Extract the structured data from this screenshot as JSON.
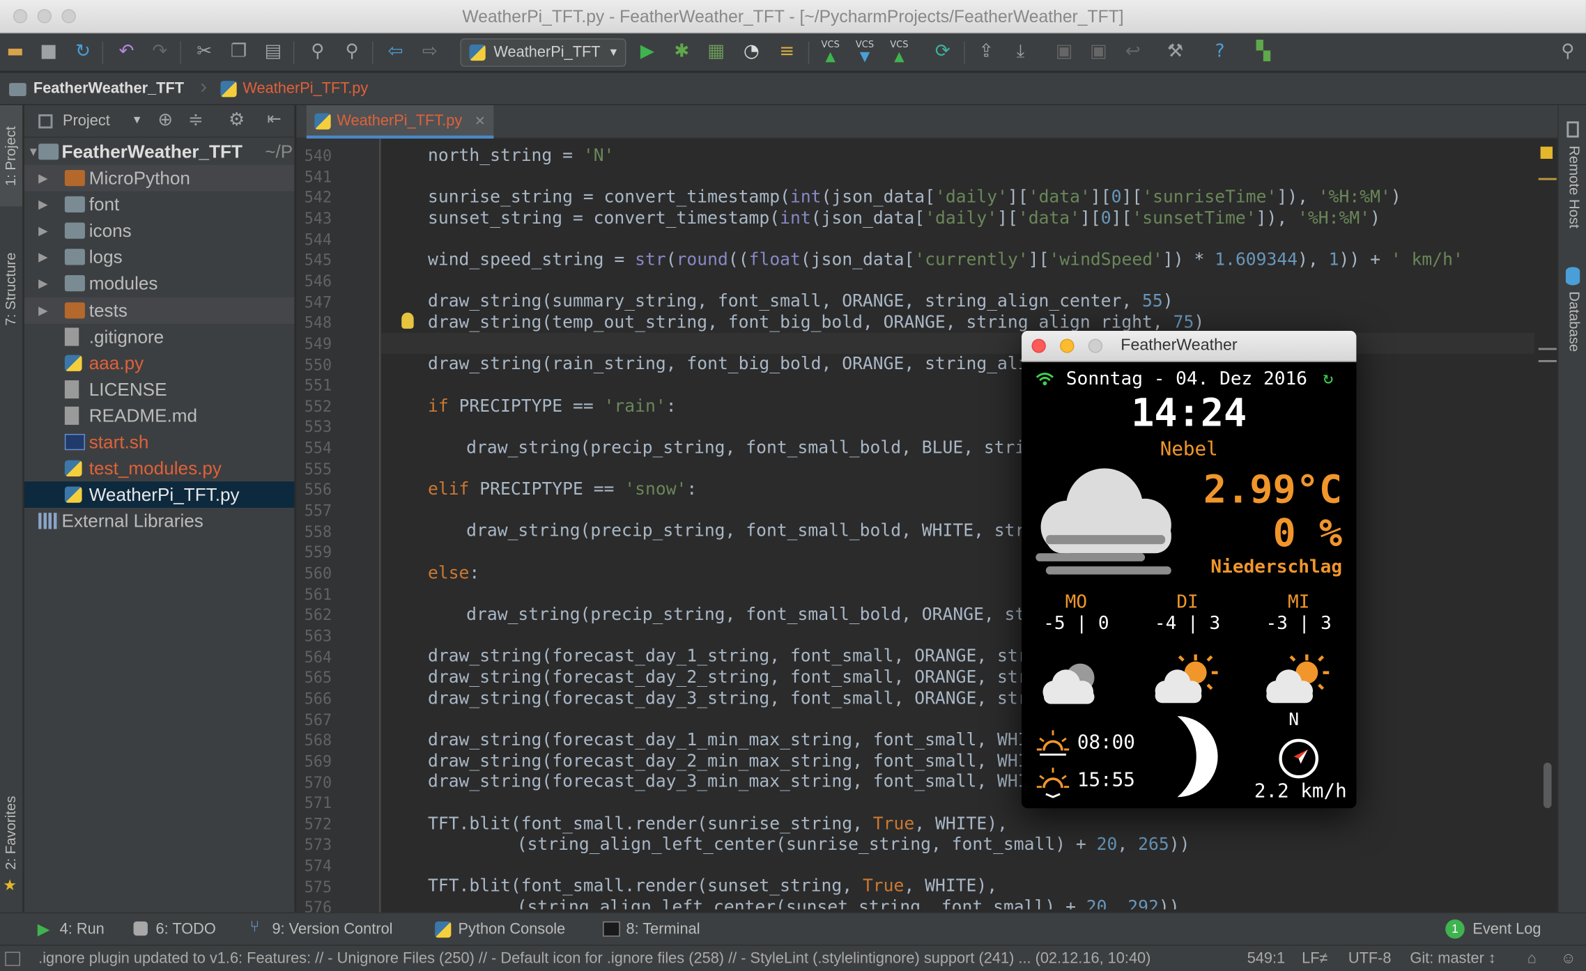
{
  "window": {
    "title": "WeatherPi_TFT.py - FeatherWeather_TFT - [~/PycharmProjects/FeatherWeather_TFT]"
  },
  "toolbar": {
    "run_config": "WeatherPi_TFT"
  },
  "navbar": {
    "project": "FeatherWeather_TFT",
    "file": "WeatherPi_TFT.py"
  },
  "left_strip": {
    "project_tab": "1: Project",
    "structure_tab": "7: Structure",
    "favorites_tab": "2: Favorites"
  },
  "project_panel": {
    "header": "Project",
    "root": "FeatherWeather_TFT",
    "root_path": "~/P",
    "items": [
      {
        "label": "MicroPython",
        "kind": "folder"
      },
      {
        "label": "font",
        "kind": "folder-gray"
      },
      {
        "label": "icons",
        "kind": "folder-gray"
      },
      {
        "label": "logs",
        "kind": "folder-gray"
      },
      {
        "label": "modules",
        "kind": "folder-gray"
      },
      {
        "label": "tests",
        "kind": "folder"
      },
      {
        "label": ".gitignore",
        "kind": "file"
      },
      {
        "label": "aaa.py",
        "kind": "py-red"
      },
      {
        "label": "LICENSE",
        "kind": "file"
      },
      {
        "label": "README.md",
        "kind": "file"
      },
      {
        "label": "start.sh",
        "kind": "sh-red"
      },
      {
        "label": "test_modules.py",
        "kind": "py-red"
      },
      {
        "label": "WeatherPi_TFT.py",
        "kind": "py-selected"
      },
      {
        "label": "External Libraries",
        "kind": "libs"
      }
    ]
  },
  "editor": {
    "tab": "WeatherPi_TFT.py",
    "line_numbers": [
      "540",
      "541",
      "542",
      "543",
      "544",
      "545",
      "546",
      "547",
      "548",
      "549",
      "550",
      "551",
      "552",
      "553",
      "554",
      "555",
      "556",
      "557",
      "558",
      "559",
      "560",
      "561",
      "562",
      "563",
      "564",
      "565",
      "566",
      "567",
      "568",
      "569",
      "570",
      "571",
      "572",
      "573",
      "574",
      "575",
      "576"
    ]
  },
  "right_strip": {
    "remote_host": "Remote Host",
    "database": "Database"
  },
  "bottom_tools": {
    "run": "4: Run",
    "todo": "6: TODO",
    "vcs": "9: Version Control",
    "console": "Python Console",
    "terminal": "8: Terminal",
    "event_log": "Event Log",
    "event_count": "1"
  },
  "status": {
    "message": ".ignore plugin updated to v1.6: Features: // - Unignore Files (250) // - Default icon for .ignore files (258) // - StyleLint (.stylelintignore) support (241) ... (02.12.16, 10:40)",
    "position": "549:1",
    "line_sep": "LF≠",
    "encoding": "UTF-8",
    "git": "Git: master ↕"
  },
  "feather": {
    "title": "FeatherWeather",
    "date": "Sonntag - 04. Dez 2016",
    "time": "14:24",
    "summary": "Nebel",
    "temp": "2.99°C",
    "precip": "0 %",
    "precip_label": "Niederschlag",
    "days": [
      {
        "name": "MO",
        "minmax": "-5 | 0"
      },
      {
        "name": "DI",
        "minmax": "-4 | 3"
      },
      {
        "name": "MI",
        "minmax": "-3 | 3"
      }
    ],
    "sunrise": "08:00",
    "sunset": "15:55",
    "wind_dir": "N",
    "wind_speed": "2.2 km/h",
    "colors": {
      "orange": "#f0962b",
      "white": "#ffffff",
      "background": "#000000"
    }
  }
}
